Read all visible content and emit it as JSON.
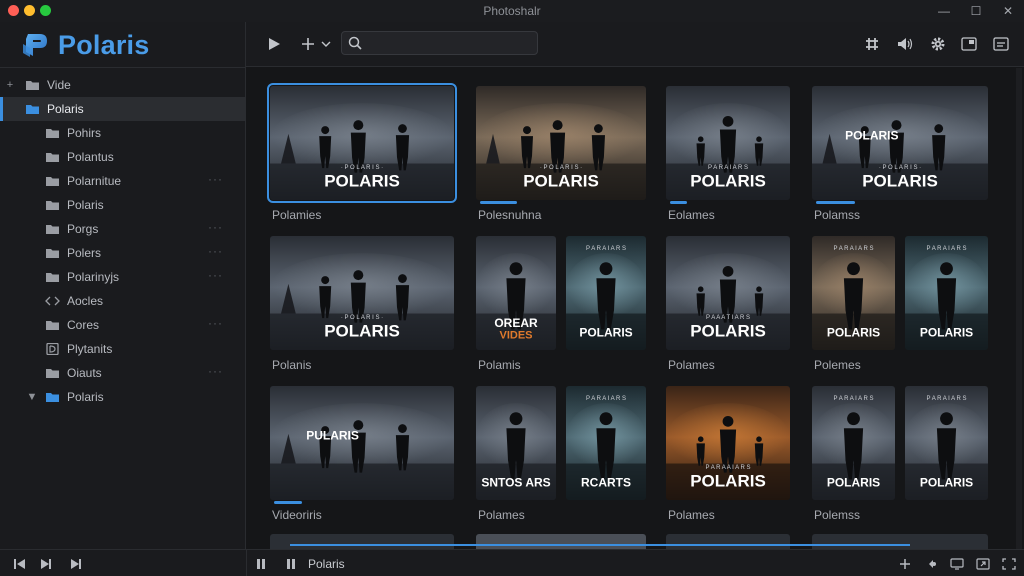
{
  "window": {
    "title": "Photoshalr",
    "colors": {
      "close": "#ff5f56",
      "minimize": "#ffbd2e",
      "zoom": "#27c93f"
    }
  },
  "app": {
    "name": "Polaris",
    "accent": "#3b8fe0",
    "logo_color": "#4a9ce8"
  },
  "toolbar": {
    "search_placeholder": "",
    "icons": [
      "play-icon",
      "add-icon",
      "chevron-down-icon",
      "search-icon",
      "grid-icon",
      "volume-icon",
      "gear-icon",
      "picture-in-picture-icon",
      "subtitles-icon"
    ]
  },
  "sidebar": {
    "tree": [
      {
        "label": "Vide",
        "icon": "folder-icon",
        "expander": "+",
        "level": 0
      },
      {
        "label": "Polaris",
        "icon": "folder-icon",
        "expander": "",
        "level": 0,
        "selected": true
      },
      {
        "label": "Pohirs",
        "icon": "folder-icon",
        "level": 1
      },
      {
        "label": "Polantus",
        "icon": "folder-icon",
        "level": 1
      },
      {
        "label": "Polarnitue",
        "icon": "folder-icon",
        "level": 1,
        "more": "···"
      },
      {
        "label": "Polaris",
        "icon": "folder-icon",
        "level": 1
      },
      {
        "label": "Porgs",
        "icon": "folder-icon",
        "level": 1,
        "more": "···"
      },
      {
        "label": "Polers",
        "icon": "folder-icon",
        "level": 1,
        "more": "···"
      },
      {
        "label": "Polarinyjs",
        "icon": "folder-icon",
        "level": 1,
        "more": "···"
      },
      {
        "label": "Aocles",
        "icon": "code-icon",
        "level": 1
      },
      {
        "label": "Cores",
        "icon": "folder-icon",
        "level": 1,
        "more": "···"
      },
      {
        "label": "Plytanits",
        "icon": "document-icon",
        "level": 1
      },
      {
        "label": "Oiauts",
        "icon": "folder-icon",
        "level": 1,
        "more": "···"
      },
      {
        "label": "Polaris",
        "icon": "folder-icon",
        "expander": "▼",
        "level": 1,
        "blue": true
      }
    ]
  },
  "gallery": {
    "cards": [
      {
        "caption": "Polamies",
        "posters": [
          {
            "title": "POLARIS",
            "tagline": "·  P O L A R I S  ·",
            "scene": "wide",
            "tone": "grey"
          }
        ],
        "focused": true,
        "progress": 0
      },
      {
        "caption": "Polesnuhna",
        "posters": [
          {
            "title": "POLARIS",
            "tagline": "· P O L A R I S ·",
            "scene": "wide",
            "tone": "warm"
          }
        ],
        "progress": 0.22
      },
      {
        "caption": "Eolames",
        "posters": [
          {
            "title": "POLARIS",
            "tagline": "P A R A I A R S",
            "scene": "square",
            "tone": "grey"
          }
        ],
        "progress": 0.14
      },
      {
        "caption": "Polamss",
        "posters": [
          {
            "title": "POLARIS",
            "tagline": "· P O L A R I S ·",
            "overlay": "POLARIS",
            "scene": "wide",
            "tone": "grey"
          }
        ],
        "progress": 0.22
      },
      {
        "caption": "Polanis",
        "posters": [
          {
            "title": "POLARIS",
            "tagline": "· P O L A R I S ·",
            "scene": "wide",
            "tone": "grey"
          }
        ]
      },
      {
        "caption": "Polamis",
        "posters": [
          {
            "title": "OREAR",
            "subtitle": "VIDES",
            "scene": "poster",
            "tone": "grey"
          },
          {
            "title": "POLARIS",
            "tagline": "P A R A I A R S",
            "scene": "poster",
            "tone": "teal"
          }
        ]
      },
      {
        "caption": "Polames",
        "posters": [
          {
            "title": "POLARIS",
            "tagline": "P A A A T I A R S",
            "scene": "square",
            "tone": "grey"
          }
        ]
      },
      {
        "caption": "Polemes",
        "posters": [
          {
            "title": "POLARIS",
            "tagline": "P A R A I A R S",
            "scene": "poster",
            "tone": "warm"
          },
          {
            "title": "POLARIS",
            "tagline": "P A R A I A R S",
            "scene": "poster",
            "tone": "teal"
          }
        ]
      },
      {
        "caption": "Videoriris",
        "posters": [
          {
            "title": "",
            "overlay": "PULARIS",
            "scene": "wide",
            "tone": "grey"
          }
        ],
        "progress": 0.15
      },
      {
        "caption": "Polames",
        "posters": [
          {
            "title": "SNTOS ARS",
            "scene": "poster",
            "tone": "grey"
          },
          {
            "title": "RCARTS",
            "tagline": "P A R A I A R S",
            "scene": "poster",
            "tone": "teal"
          }
        ]
      },
      {
        "caption": "Polames",
        "posters": [
          {
            "title": "POLARIS",
            "tagline": "P A R A A I A R S",
            "scene": "square",
            "tone": "orange"
          }
        ]
      },
      {
        "caption": "Polemss",
        "posters": [
          {
            "title": "POLARIS",
            "tagline": "P A R A I A R S",
            "scene": "poster",
            "tone": "grey"
          },
          {
            "title": "POLARIS",
            "tagline": "P A R A I A R S",
            "scene": "poster",
            "tone": "grey"
          }
        ]
      }
    ]
  },
  "player": {
    "now_playing": "Polaris",
    "icons": [
      "pause-icon",
      "pause-icon",
      "add-icon",
      "cast-icon",
      "screen-icon",
      "expand-icon",
      "fullscreen-icon"
    ],
    "progress": 0.6
  }
}
